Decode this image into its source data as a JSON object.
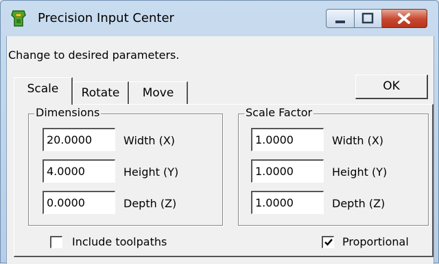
{
  "window": {
    "title": "Precision Input Center"
  },
  "instruction": "Change to desired parameters.",
  "tabs": [
    {
      "label": "Scale",
      "selected": true
    },
    {
      "label": "Rotate",
      "selected": false
    },
    {
      "label": "Move",
      "selected": false
    }
  ],
  "ok_label": "OK",
  "dimensions": {
    "legend": "Dimensions",
    "fields": [
      {
        "value": "20.0000",
        "label": "Width (X)"
      },
      {
        "value": "4.0000",
        "label": "Height (Y)"
      },
      {
        "value": "0.0000",
        "label": "Depth (Z)"
      }
    ]
  },
  "scale_factor": {
    "legend": "Scale Factor",
    "fields": [
      {
        "value": "1.0000",
        "label": "Width (X)"
      },
      {
        "value": "1.0000",
        "label": "Height (Y)"
      },
      {
        "value": "1.0000",
        "label": "Depth (Z)"
      }
    ]
  },
  "options": {
    "include_toolpaths": {
      "label": "Include toolpaths",
      "checked": false
    },
    "proportional": {
      "label": "Proportional",
      "checked": true
    }
  },
  "colors": {
    "titlebar": "#c9dcef",
    "close_button": "#c8472e",
    "dialog_bg": "#f0f0f0"
  }
}
